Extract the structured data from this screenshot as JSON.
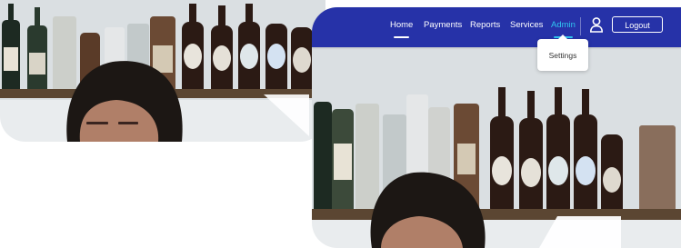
{
  "nav": {
    "items": [
      {
        "label": "Home"
      },
      {
        "label": "Payments"
      },
      {
        "label": "Reports"
      },
      {
        "label": "Services"
      },
      {
        "label": "Admin"
      }
    ],
    "logout_label": "Logout",
    "user_icon": "user-icon"
  },
  "admin_menu": {
    "items": [
      {
        "label": "Settings"
      }
    ]
  },
  "colors": {
    "navbar": "#2632a8",
    "active_link": "#30c6f1",
    "page_background": "#ffffff"
  }
}
